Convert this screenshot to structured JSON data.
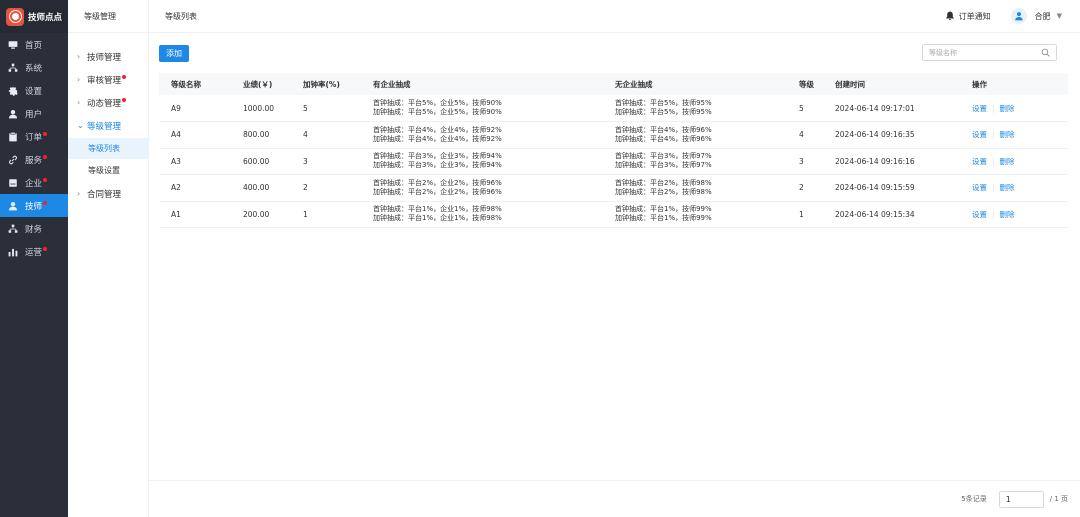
{
  "brand": {
    "name": "技师点点",
    "accent": "#e8523f"
  },
  "nav": {
    "items": [
      {
        "label": "首页",
        "icon": "monitor-icon",
        "dot": false,
        "active": false
      },
      {
        "label": "系统",
        "icon": "sitemap-icon",
        "dot": false,
        "active": false
      },
      {
        "label": "设置",
        "icon": "gear-icon",
        "dot": false,
        "active": false
      },
      {
        "label": "用户",
        "icon": "user-icon",
        "dot": false,
        "active": false
      },
      {
        "label": "订单",
        "icon": "clipboard-icon",
        "dot": true,
        "active": false
      },
      {
        "label": "服务",
        "icon": "link-icon",
        "dot": true,
        "active": false
      },
      {
        "label": "企业",
        "icon": "building-icon",
        "dot": true,
        "active": false
      },
      {
        "label": "技师",
        "icon": "user-icon",
        "dot": true,
        "active": true
      },
      {
        "label": "财务",
        "icon": "sitemap-icon",
        "dot": false,
        "active": false
      },
      {
        "label": "运营",
        "icon": "chart-icon",
        "dot": true,
        "active": false
      }
    ]
  },
  "submenu": {
    "title": "等级管理",
    "items": [
      {
        "label": "技师管理",
        "dot": false
      },
      {
        "label": "审核管理",
        "dot": true
      },
      {
        "label": "动态管理",
        "dot": true
      },
      {
        "label": "等级管理",
        "dot": false,
        "open": true
      },
      {
        "label": "合同管理",
        "dot": false
      }
    ],
    "children": [
      "等级列表",
      "等级设置"
    ]
  },
  "header": {
    "page_title": "等级列表",
    "notice": "订单通知",
    "city": "合肥"
  },
  "toolbar": {
    "add_label": "添加",
    "search_placeholder": "等级名称"
  },
  "table": {
    "columns": [
      "等级名称",
      "业绩(￥)",
      "加钟率(%)",
      "有企业抽成",
      "无企业抽成",
      "等级",
      "创建时间",
      "操作"
    ],
    "rows": [
      {
        "name": "A9",
        "amount": "1000.00",
        "rate": "5",
        "with_ent": [
          "首钟抽成：平台5%，企业5%，技师90%",
          "加钟抽成：平台5%，企业5%，技师90%"
        ],
        "no_ent": [
          "首钟抽成：平台5%，技师95%",
          "加钟抽成：平台5%，技师95%"
        ],
        "level": "5",
        "created": "2024-06-14 09:17:01"
      },
      {
        "name": "A4",
        "amount": "800.00",
        "rate": "4",
        "with_ent": [
          "首钟抽成：平台4%，企业4%，技师92%",
          "加钟抽成：平台4%，企业4%，技师92%"
        ],
        "no_ent": [
          "首钟抽成：平台4%，技师96%",
          "加钟抽成：平台4%，技师96%"
        ],
        "level": "4",
        "created": "2024-06-14 09:16:35"
      },
      {
        "name": "A3",
        "amount": "600.00",
        "rate": "3",
        "with_ent": [
          "首钟抽成：平台3%，企业3%，技师94%",
          "加钟抽成：平台3%，企业3%，技师94%"
        ],
        "no_ent": [
          "首钟抽成：平台3%，技师97%",
          "加钟抽成：平台3%，技师97%"
        ],
        "level": "3",
        "created": "2024-06-14 09:16:16"
      },
      {
        "name": "A2",
        "amount": "400.00",
        "rate": "2",
        "with_ent": [
          "首钟抽成：平台2%，企业2%，技师96%",
          "加钟抽成：平台2%，企业2%，技师96%"
        ],
        "no_ent": [
          "首钟抽成：平台2%，技师98%",
          "加钟抽成：平台2%，技师98%"
        ],
        "level": "2",
        "created": "2024-06-14 09:15:59"
      },
      {
        "name": "A1",
        "amount": "200.00",
        "rate": "1",
        "with_ent": [
          "首钟抽成：平台1%，企业1%，技师98%",
          "加钟抽成：平台1%，企业1%，技师98%"
        ],
        "no_ent": [
          "首钟抽成：平台1%，技师99%",
          "加钟抽成：平台1%，技师99%"
        ],
        "level": "1",
        "created": "2024-06-14 09:15:34"
      }
    ],
    "actions": {
      "edit": "设置",
      "delete": "删除"
    }
  },
  "pagination": {
    "total": "5条记录",
    "current": "1",
    "pages": "/ 1 页"
  }
}
